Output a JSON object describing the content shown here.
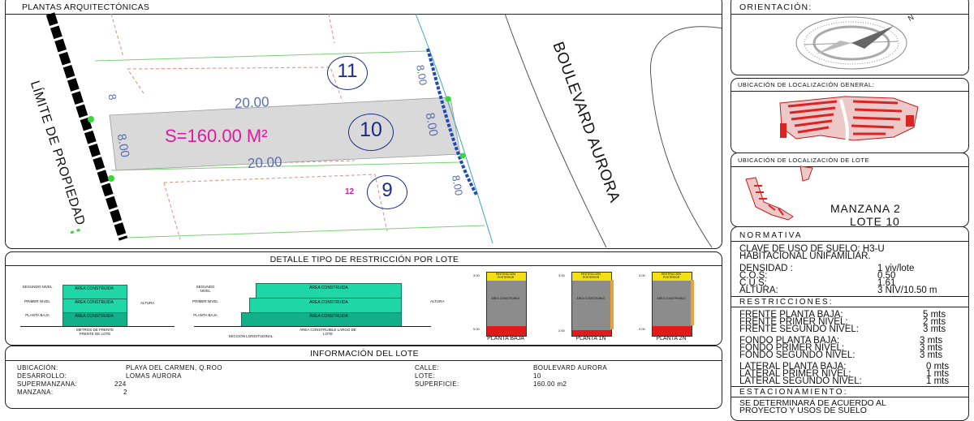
{
  "plantas": {
    "title": "PLANTAS ARQUITECTÓNICAS",
    "lots": {
      "top": "11",
      "center": "10",
      "bottom": "9"
    },
    "dim_width": "20.00",
    "dim_width_bottom": "20.00",
    "dim_depth": "8.00",
    "dim_depth_left": "8.00",
    "dim_left_small": "8",
    "dim_right_top": "8.00",
    "dim_right_bottom": "8.00",
    "area_label": "S=160.00 M²",
    "magenta_small": "12",
    "road_label": "BOULEVARD AURORA",
    "boundary_label": "LÍMITE DE PROPIEDAD",
    "colors": {
      "lot_fill": "#d9d9d9",
      "magenta": "#e01aa0",
      "lot_number": "#1b2b8c",
      "dim": "#5b6fb0",
      "boundary_red": "#d9907f"
    }
  },
  "orientacion": {
    "title": "ORIENTACIÓN:",
    "north_letter": "N"
  },
  "ubic_general": {
    "title": "UBICACIÓN DE LOCALIZACIÓN GENERAL:"
  },
  "ubic_lote": {
    "title": "UBICACIÓN DE LOCALIZACIÓN DE LOTE",
    "manzana": "MANZANA 2",
    "lote": "LOTE 10"
  },
  "normativa": {
    "title": "NORMATIVA",
    "clave_line1": "CLAVE DE USO DE SUELO:  H3-U",
    "clave_line2": "HABITACIONAL UNIFAMILIAR.",
    "rows": [
      {
        "label": "DENSIDAD :",
        "value": "1 viv/lote"
      },
      {
        "label": "C.O.S:",
        "value": "0.50"
      },
      {
        "label": "C.U.S:",
        "value": "1.61"
      },
      {
        "label": "ALTURA:",
        "value": "3 NIV/10.50 m"
      }
    ]
  },
  "restricciones": {
    "title": "RESTRICCIONES:",
    "rows": [
      {
        "label": "FRENTE PLANTA BAJA:",
        "value": "5 mts"
      },
      {
        "label": "FRENTE PRIMER NIVEL:",
        "value": "2 mts"
      },
      {
        "label": "FRENTE SEGUNDO NIVEL:",
        "value": "3 mts"
      },
      {
        "label": "FONDO PLANTA BAJA:",
        "value": "3 mts"
      },
      {
        "label": "FONDO PRIMER NIVEL:",
        "value": "3 mts"
      },
      {
        "label": "FONDO SEGUNDO NIVEL:",
        "value": "3 mts"
      },
      {
        "label": "LATERAL PLANTA BAJA:",
        "value": "0 mts"
      },
      {
        "label": "LATERAL PRIMER NIVEL:",
        "value": "1 mts"
      },
      {
        "label": "LATERAL SEGUNDO NIVEL:",
        "value": "1 mts"
      }
    ]
  },
  "estacionamiento": {
    "title": "ESTACIONAMIENTO:",
    "line1": "SE  DETERMINARÁ  DE  ACUERDO  AL",
    "line2": "PROYECTO     Y     USOS     DE     SUELO"
  },
  "detalle": {
    "title": "DETALLE TIPO DE RESTRICCIÓN POR LOTE",
    "area_label": "ÁREA CONSTRUIDA",
    "level_labels": [
      "SEGUNDO NIVEL",
      "PRIMER NIVEL",
      "PLANTA BAJA"
    ],
    "altura_label": "ALTURA",
    "caption1": "METROS DE FRENTE FRENTE DE LOTE",
    "caption2": "ÁREA CONSTRUIBLE LARGO DE LOTE",
    "caption_section": "SECCIÓN LONGITUDINAL",
    "plan_top_label": "RESTRICCIÓN POSTERIOR",
    "plan_mid_label": "ÁREA CONSTRUIBLE",
    "plans": [
      "PLANTA BAJA",
      "PLANTA 1N",
      "PLANTA 2N"
    ],
    "plan_dims": [
      "3.00",
      "5.00",
      "3.00",
      "2.00",
      "3.00",
      "3.00"
    ],
    "colors": {
      "teal_light": "#1fd6a6",
      "teal_dark": "#12b08a",
      "yellow": "#f3df16",
      "gray": "#8c8c8c",
      "red": "#e31a1a",
      "orange": "#e8a040"
    }
  },
  "info": {
    "title": "INFORMACIÓN DEL LOTE",
    "left": [
      {
        "label": "UBICACIÓN:",
        "value": "PLAYA DEL CARMEN, Q.ROO"
      },
      {
        "label": "DESARROLLO:",
        "value": "LOMAS AURORA"
      },
      {
        "label": "SUPERMANZANA:",
        "value": "224"
      },
      {
        "label": "MANZANA:",
        "value": "2"
      }
    ],
    "right": [
      {
        "label": "CALLE:",
        "value": "BOULEVARD AURORA"
      },
      {
        "label": "LOTE:",
        "value": "10"
      },
      {
        "label": "SUPERFICIE:",
        "value": "160.00 m2"
      }
    ]
  }
}
